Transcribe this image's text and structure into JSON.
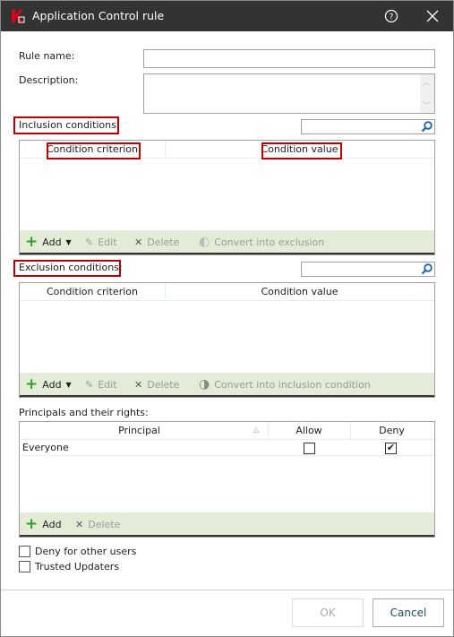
{
  "window": {
    "title": "Application Control rule",
    "help_icon": "help-circle-icon",
    "close_icon": "close-icon",
    "brand_color": "#e3001b"
  },
  "form": {
    "rule_name_label": "Rule name:",
    "rule_name_value": "",
    "description_label": "Description:",
    "description_value": ""
  },
  "inclusion": {
    "label": "Inclusion conditions:",
    "search_value": "",
    "columns": [
      "Condition criterion",
      "Condition value"
    ],
    "rows": [],
    "toolbar": {
      "add": "Add",
      "edit": "Edit",
      "delete": "Delete",
      "convert": "Convert into exclusion"
    }
  },
  "exclusion": {
    "label": "Exclusion conditions:",
    "search_value": "",
    "columns": [
      "Condition criterion",
      "Condition value"
    ],
    "rows": [],
    "toolbar": {
      "add": "Add",
      "edit": "Edit",
      "delete": "Delete",
      "convert": "Convert into inclusion condition"
    }
  },
  "principals": {
    "label": "Principals and their rights:",
    "columns": [
      "Principal",
      "Allow",
      "Deny"
    ],
    "rows": [
      {
        "principal": "Everyone",
        "allow": false,
        "deny": true
      }
    ],
    "toolbar": {
      "add": "Add",
      "delete": "Delete"
    }
  },
  "options": {
    "deny_other_users": {
      "label": "Deny for other users",
      "checked": false
    },
    "trusted_updaters": {
      "label": "Trusted Updaters",
      "checked": false
    }
  },
  "footer": {
    "ok": "OK",
    "cancel": "Cancel"
  },
  "colors": {
    "toolbar_bg": "#e4ecd8",
    "highlight": "#c00000",
    "titlebar": "#333333"
  }
}
